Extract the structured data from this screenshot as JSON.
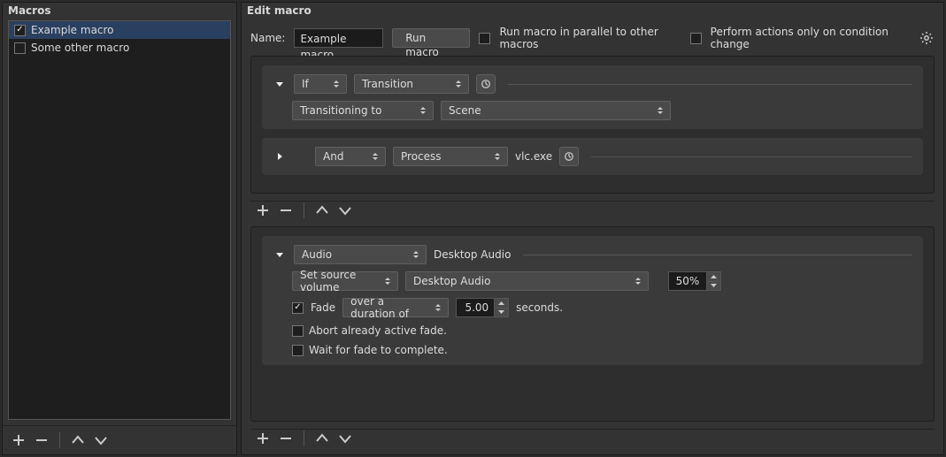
{
  "left": {
    "title": "Macros",
    "items": [
      {
        "label": "Example macro",
        "checked": true,
        "selected": true
      },
      {
        "label": "Some other macro",
        "checked": false,
        "selected": false
      }
    ]
  },
  "right": {
    "title": "Edit macro",
    "name_label": "Name:",
    "name_value": "Example macro",
    "run_button": "Run macro",
    "parallel_label": "Run macro in parallel to other macros",
    "parallel_checked": false,
    "condition_label": "Perform actions only on condition change",
    "condition_checked": false
  },
  "conditions": [
    {
      "expanded": true,
      "logic": "If",
      "type": "Transition",
      "detail": {
        "field": "Transitioning to",
        "target": "Scene"
      }
    },
    {
      "expanded": false,
      "logic": "And",
      "type": "Process",
      "value": "vlc.exe"
    }
  ],
  "actions": [
    {
      "expanded": true,
      "type": "Audio",
      "type_side": "Desktop Audio",
      "sub": {
        "method": "Set source volume",
        "source": "Desktop Audio",
        "value": "50%"
      },
      "fade": {
        "checked": true,
        "label": "Fade",
        "mode": "over a duration of",
        "duration": "5.00",
        "suffix": "seconds."
      },
      "abort": {
        "checked": false,
        "label": "Abort already active fade."
      },
      "wait": {
        "checked": false,
        "label": "Wait for fade to complete."
      }
    }
  ]
}
